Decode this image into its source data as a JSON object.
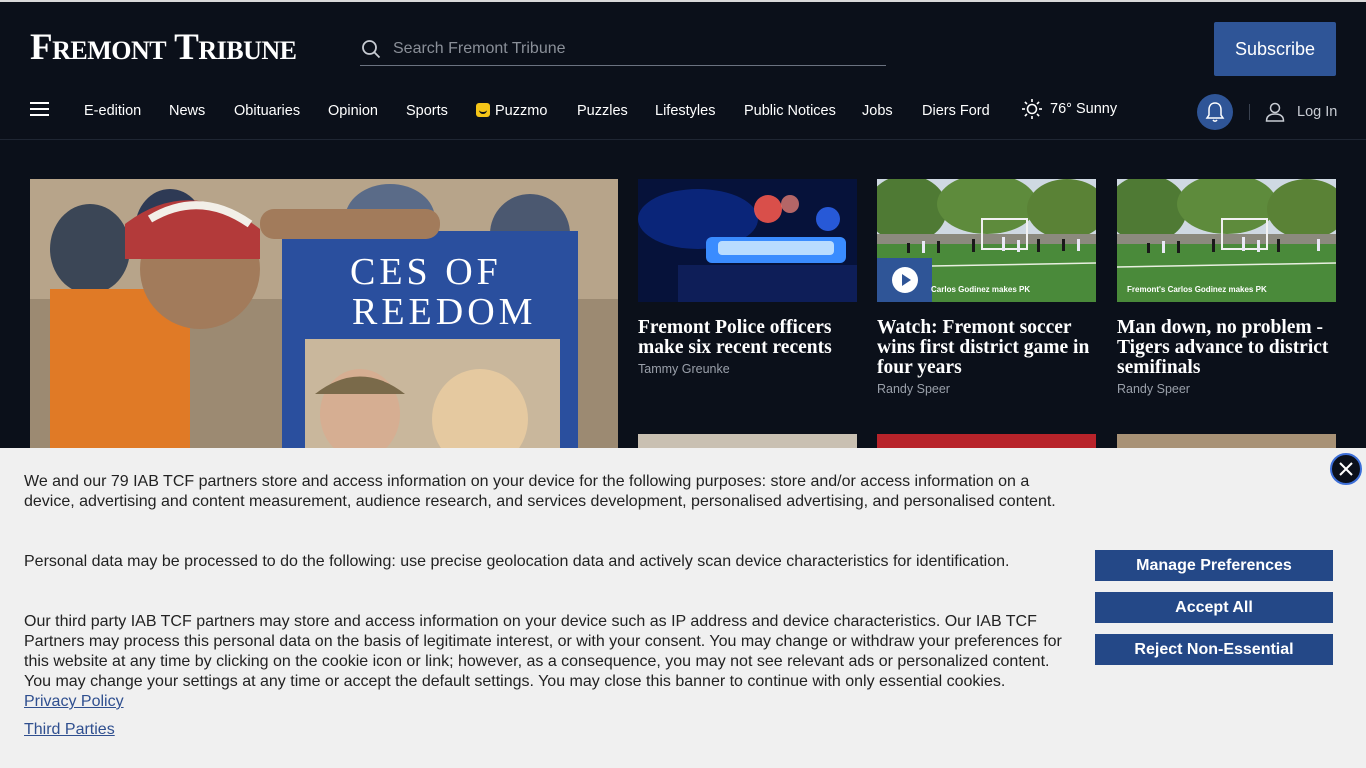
{
  "header": {
    "logo": "Fremont Tribune",
    "search_placeholder": "Search Fremont Tribune",
    "subscribe_label": "Subscribe"
  },
  "nav": {
    "items": [
      "E-edition",
      "News",
      "Obituaries",
      "Opinion",
      "Sports",
      "Puzzmo",
      "Puzzles",
      "Lifestyles",
      "Public Notices",
      "Jobs",
      "Diers Ford"
    ],
    "weather": "76° Sunny",
    "login": "Log In"
  },
  "lead": {
    "sign_text_1": "CES OF",
    "sign_text_2": "REEDOM"
  },
  "cards": [
    {
      "title": "Fremont Police officers make six recent recents",
      "author": "Tammy Greunke"
    },
    {
      "title": "Watch: Fremont soccer wins first district game in four years",
      "author": "Randy Speer",
      "caption": "Carlos Godinez makes PK"
    },
    {
      "title": "Man down, no problem - Tigers advance to district semifinals",
      "author": "Randy Speer",
      "caption": "Fremont's Carlos Godinez makes PK"
    }
  ],
  "consent": {
    "p1": "We and our 79 IAB TCF partners store and access information on your device for the following purposes: store and/or access information on a device, advertising and content measurement, audience research, and services development, personalised advertising, and personalised content.",
    "p2": "Personal data may be processed to do the following: use precise geolocation data and actively scan device characteristics for identification.",
    "p3": "Our third party IAB TCF partners may store and access information on your device such as IP address and device characteristics. Our IAB TCF Partners may process this personal data on the basis of legitimate interest, or with your consent. You may change or withdraw your preferences for this website at any time by clicking on the cookie icon or link; however, as a consequence, you may not see relevant ads or personalized content. You may change your settings at any time or accept the default settings. You may close this banner to continue with only essential cookies.",
    "privacy_link": "Privacy Policy",
    "third_parties_link": "Third Parties",
    "manage_label": "Manage Preferences",
    "accept_label": "Accept All",
    "reject_label": "Reject Non-Essential"
  },
  "colors": {
    "background": "#0b101a",
    "accent": "#2f5597",
    "consent_bg": "#f0f0f0",
    "consent_button": "#244887"
  },
  "icons": [
    "search-icon",
    "menu-icon",
    "puzzmo-icon",
    "sun-icon",
    "bell-icon",
    "user-icon",
    "play-icon",
    "close-icon"
  ]
}
